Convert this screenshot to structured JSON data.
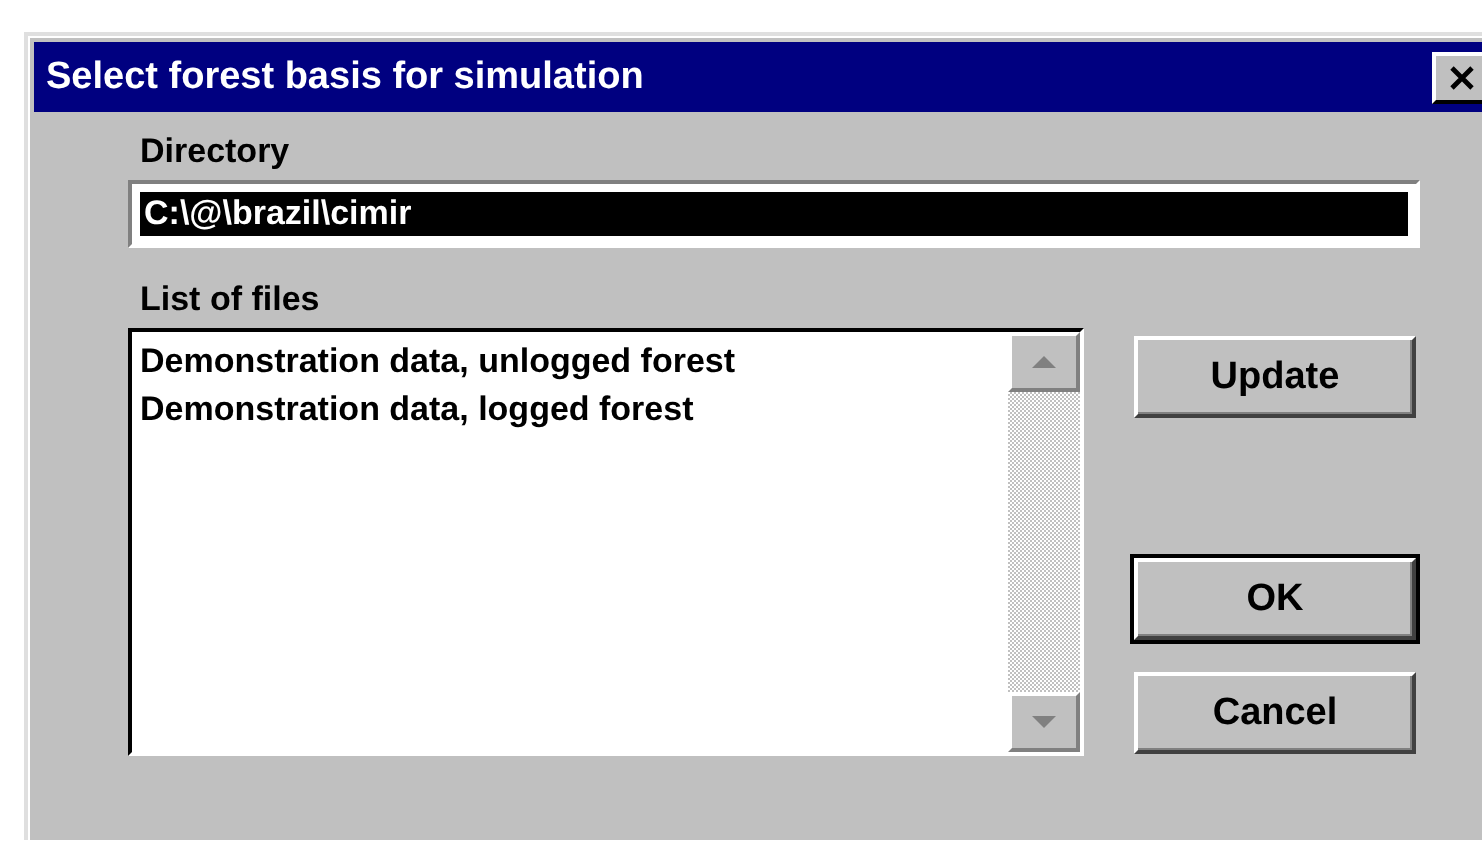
{
  "window": {
    "title": "Select forest basis for simulation"
  },
  "directory": {
    "label": "Directory",
    "value": "C:\\@\\brazil\\cimir",
    "text_selected": true
  },
  "files": {
    "label": "List of files",
    "items": [
      {
        "name": "Demonstration data, unlogged forest",
        "selected": false
      },
      {
        "name": "Demonstration data, logged forest",
        "selected": false
      }
    ]
  },
  "buttons": [
    {
      "label": "Update",
      "default": false
    },
    {
      "label": "OK",
      "default": true
    },
    {
      "label": "Cancel",
      "default": false
    }
  ]
}
